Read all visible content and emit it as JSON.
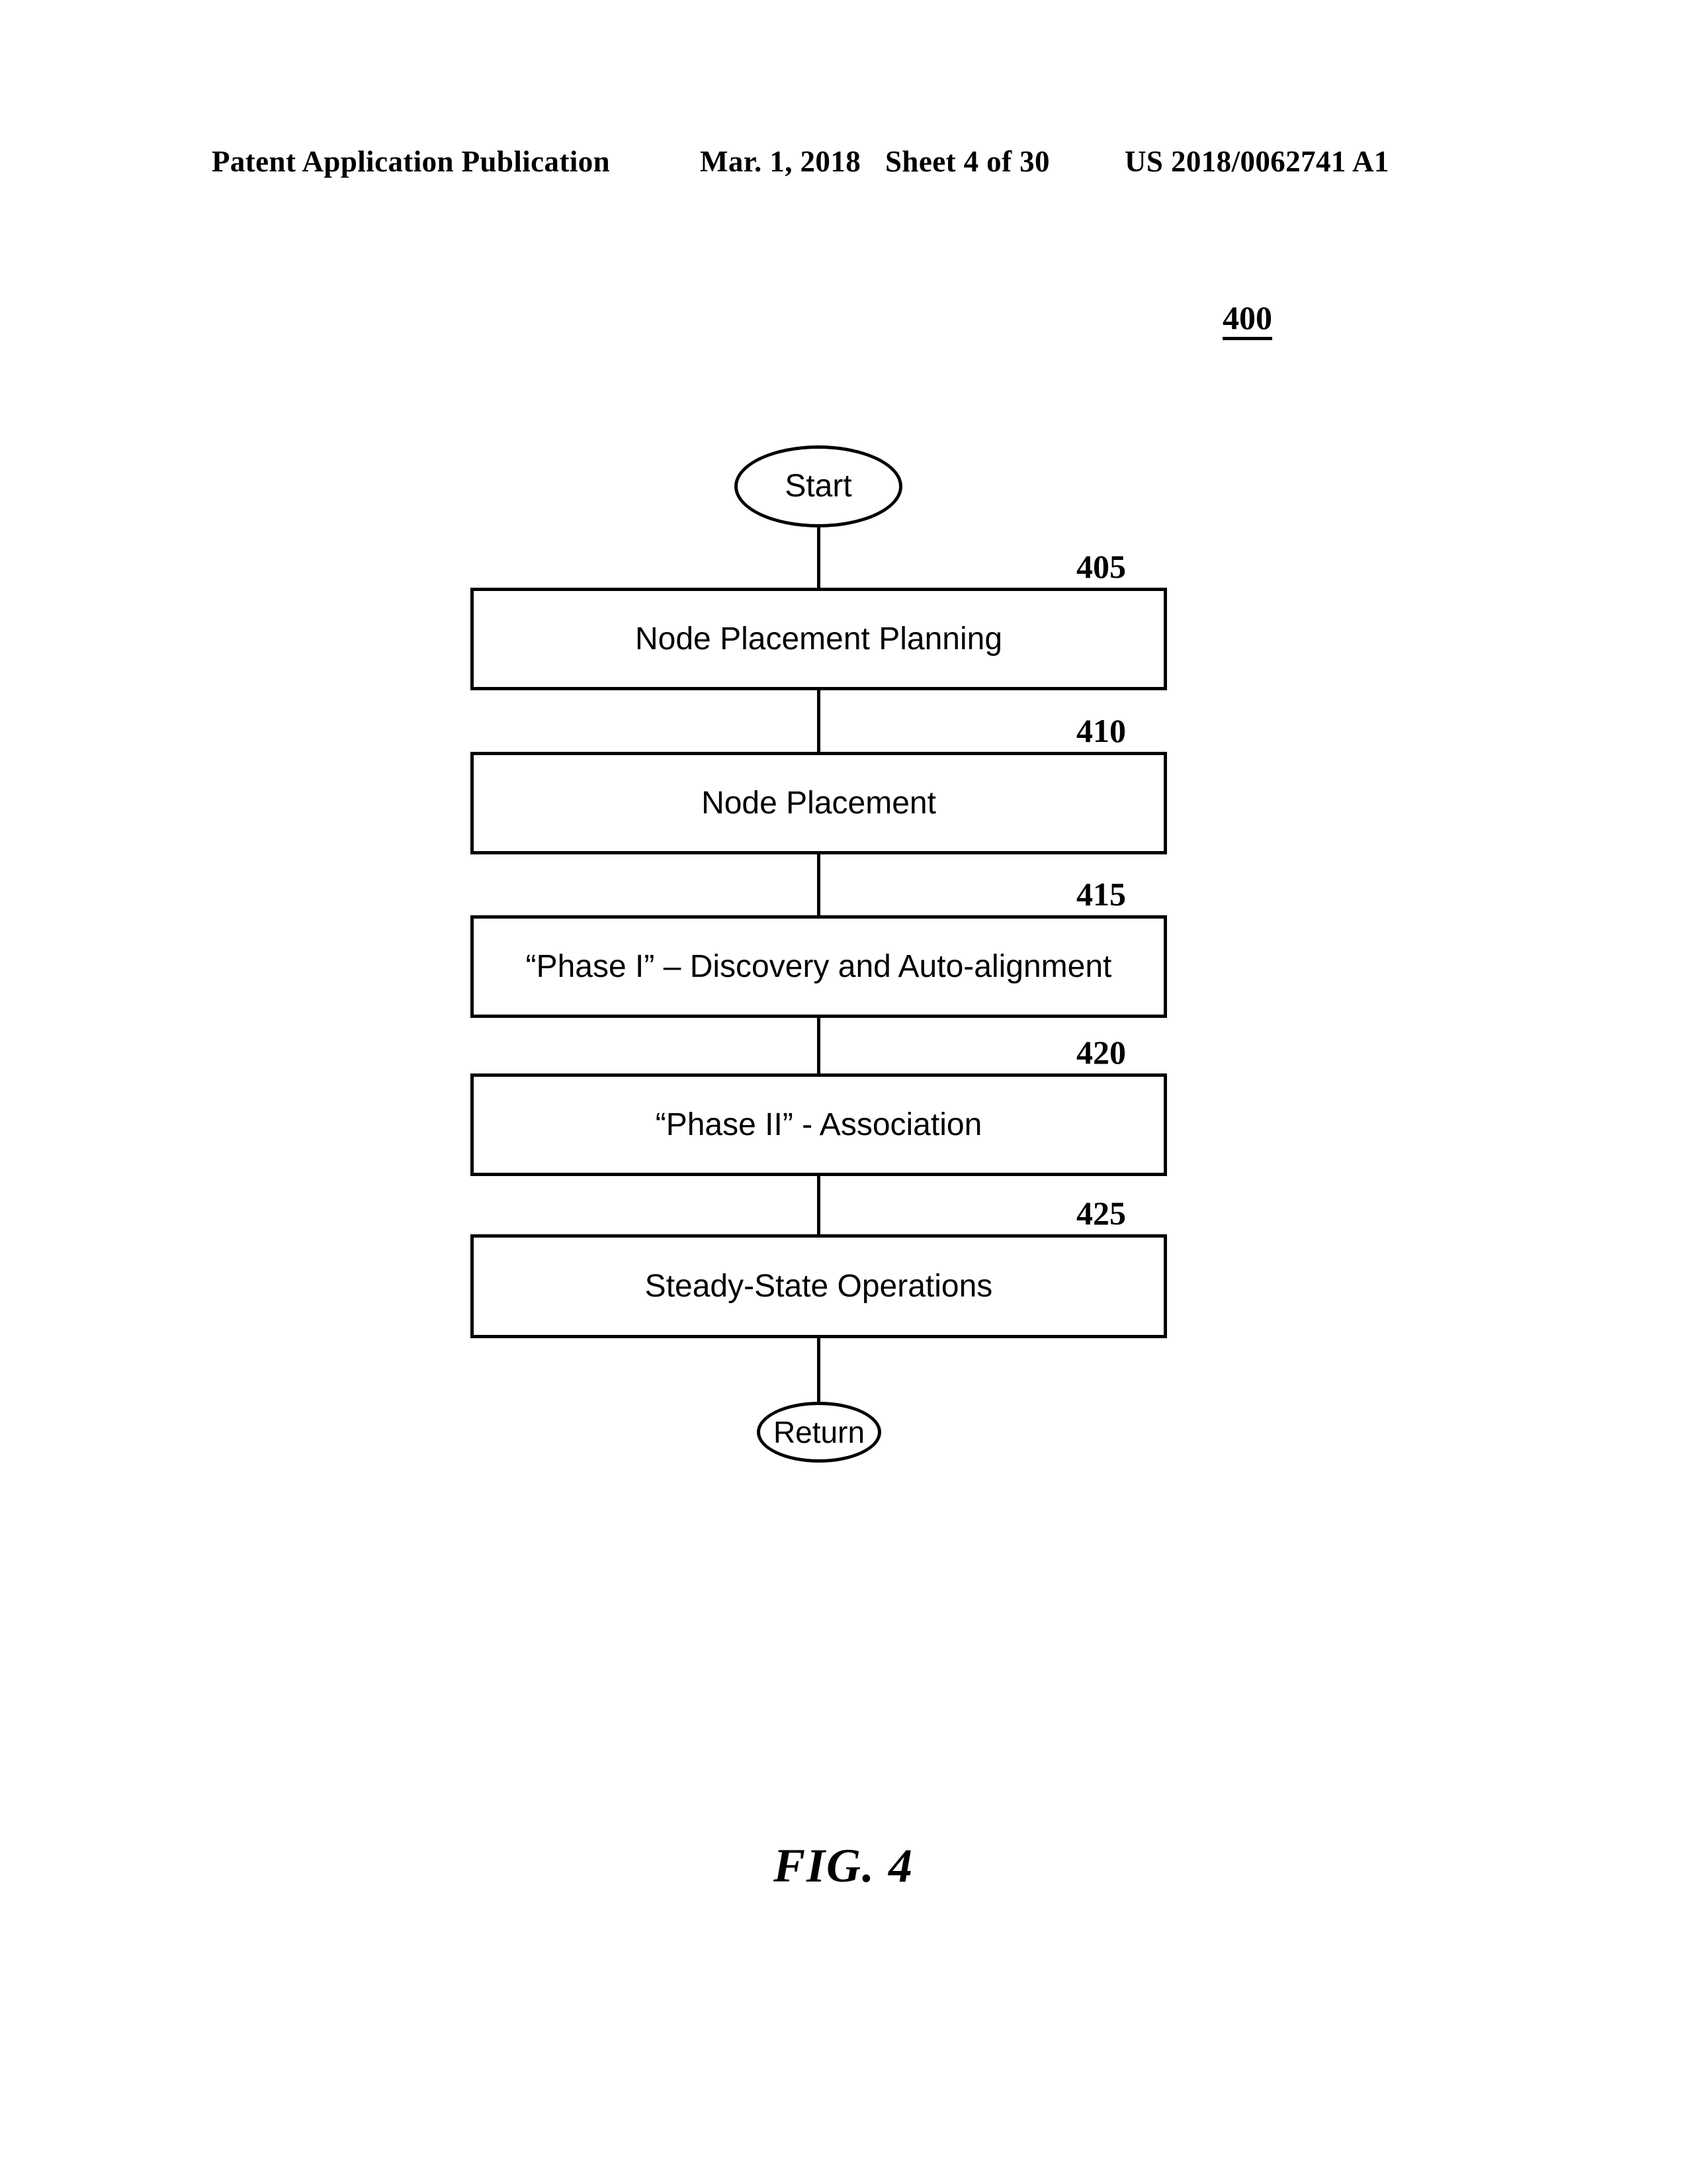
{
  "header": {
    "publication": "Patent Application Publication",
    "date": "Mar. 1, 2018",
    "sheet": "Sheet 4 of 30",
    "patent_number": "US 2018/0062741 A1"
  },
  "figure": {
    "reference_number": "400",
    "caption": "FIG. 4",
    "nodes": [
      {
        "id": "start",
        "type": "terminator",
        "label": "Start"
      },
      {
        "id": "405",
        "type": "process",
        "label": "Node Placement Planning",
        "ref": "405"
      },
      {
        "id": "410",
        "type": "process",
        "label": "Node Placement",
        "ref": "410"
      },
      {
        "id": "415",
        "type": "process",
        "label": "“Phase I” – Discovery and Auto-alignment",
        "ref": "415"
      },
      {
        "id": "420",
        "type": "process",
        "label": "“Phase II” - Association",
        "ref": "420"
      },
      {
        "id": "425",
        "type": "process",
        "label": "Steady-State Operations",
        "ref": "425"
      },
      {
        "id": "return",
        "type": "terminator",
        "label": "Return"
      }
    ]
  },
  "colors": {
    "ink": "#000000",
    "page": "#ffffff"
  }
}
